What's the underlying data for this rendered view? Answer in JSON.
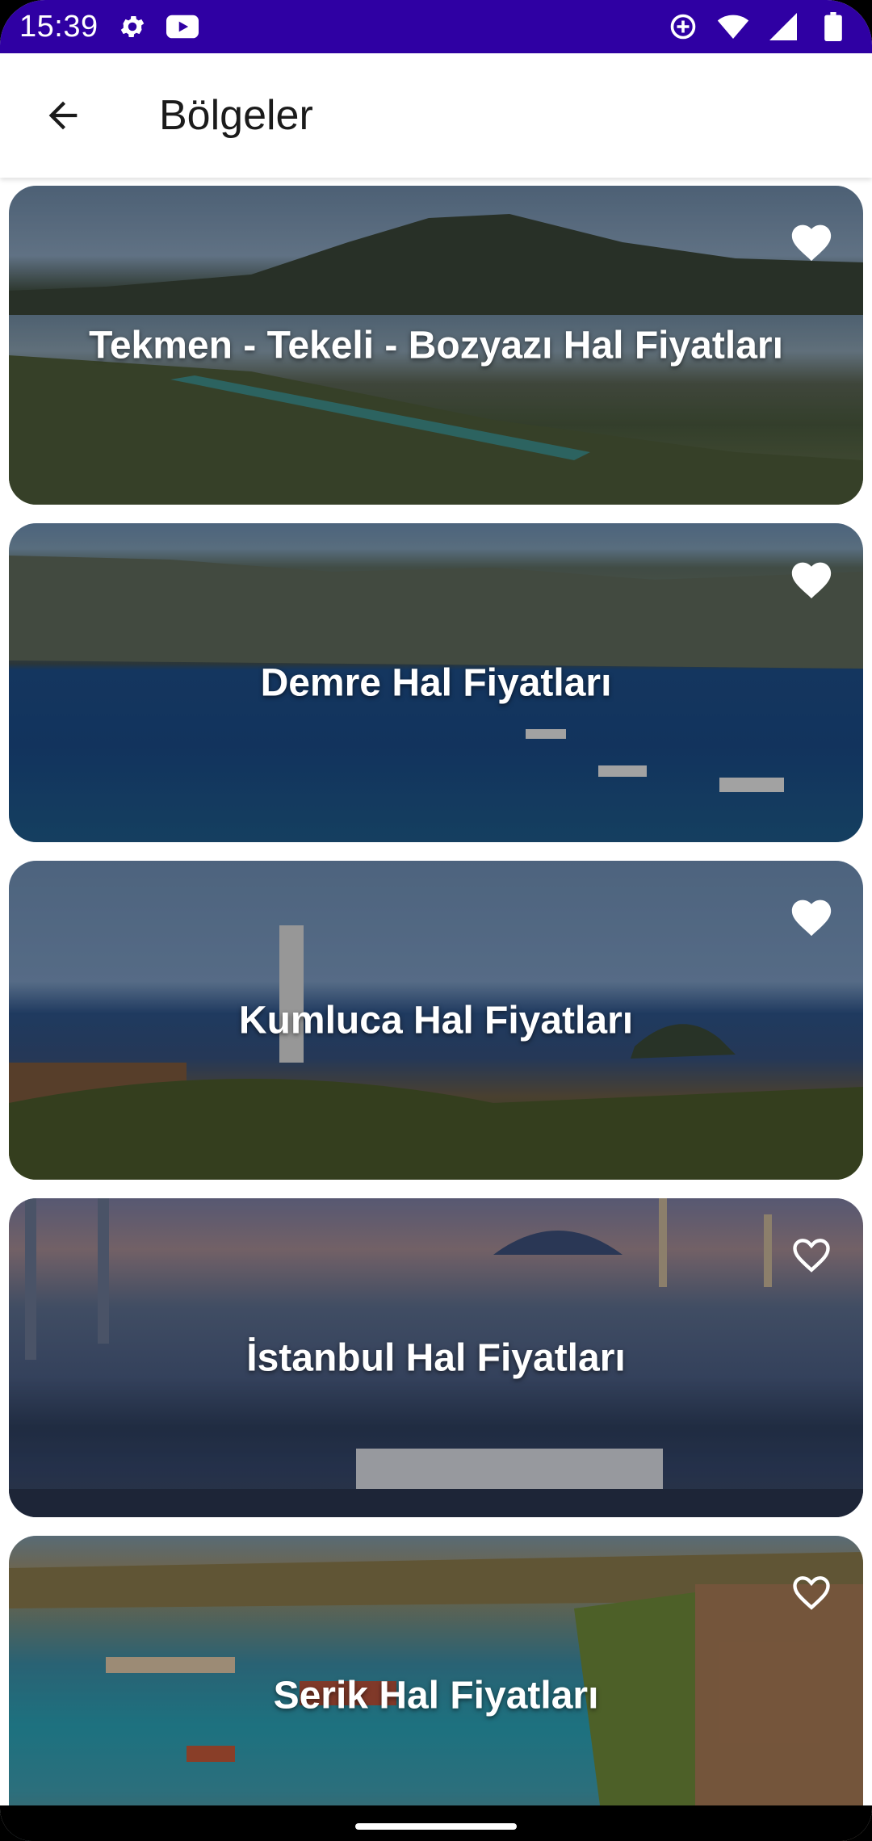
{
  "status_bar": {
    "time": "15:39",
    "left_icons": [
      "gear-icon",
      "youtube-icon"
    ],
    "right_icons": [
      "data-saver-icon",
      "wifi-icon",
      "signal-icon",
      "battery-icon"
    ],
    "color": "#2f00a3"
  },
  "app_bar": {
    "title": "Bölgeler",
    "back_icon": "arrow-back-icon"
  },
  "regions": [
    {
      "title": "Tekmen - Tekeli - Bozyazı Hal Fiyatları",
      "favorite": true
    },
    {
      "title": "Demre Hal Fiyatları",
      "favorite": true
    },
    {
      "title": "Kumluca Hal Fiyatları",
      "favorite": true
    },
    {
      "title": "İstanbul Hal Fiyatları",
      "favorite": false
    },
    {
      "title": "Serik Hal Fiyatları",
      "favorite": false
    }
  ]
}
